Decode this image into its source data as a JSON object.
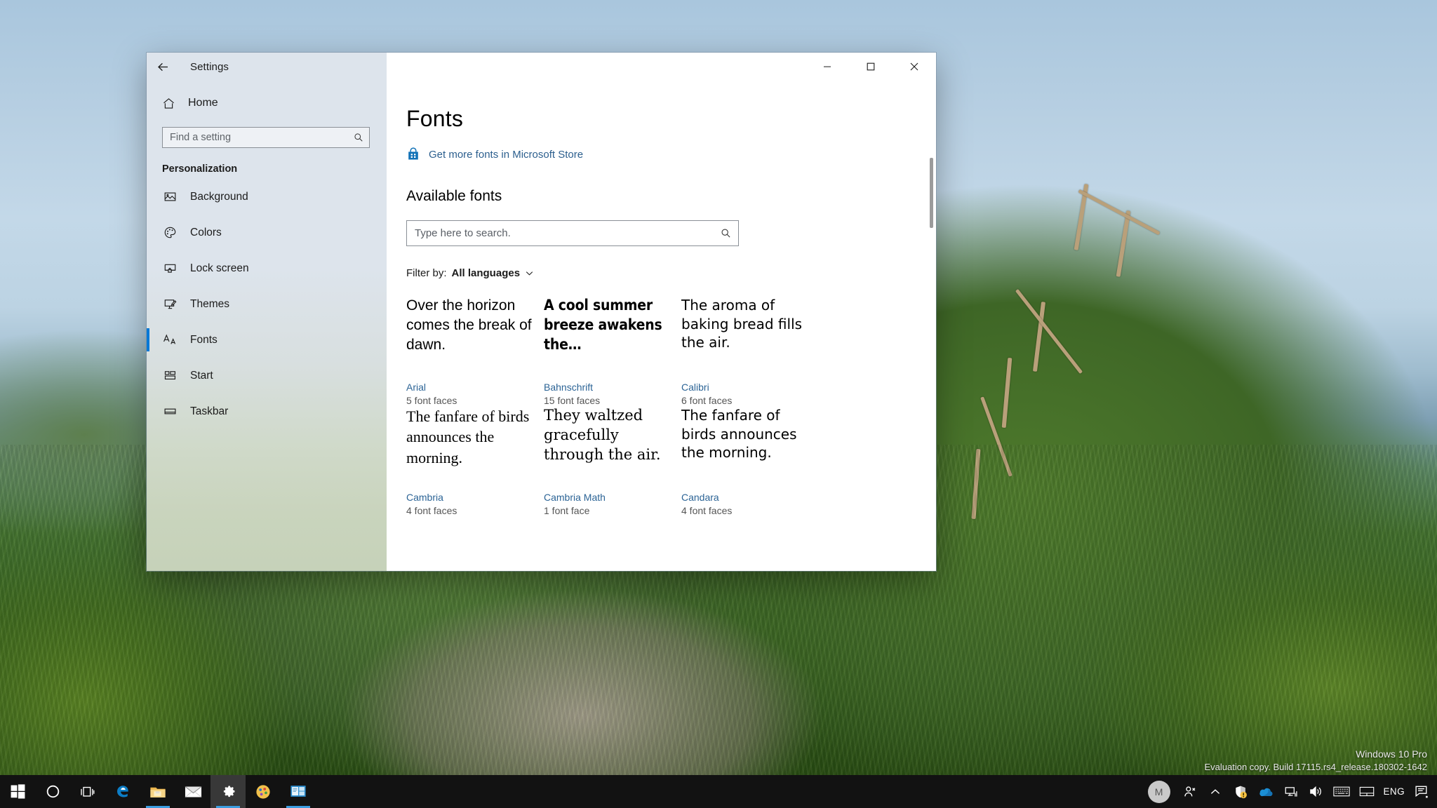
{
  "desktop": {
    "watermark": {
      "line1": "Windows 10 Pro",
      "line2": "Evaluation copy. Build 17115.rs4_release.180302-1642"
    }
  },
  "window": {
    "title": "Settings",
    "back_icon": "back-arrow-icon",
    "controls": {
      "minimize": "─",
      "maximize": "☐",
      "close": "✕"
    }
  },
  "sidebar": {
    "home_label": "Home",
    "search": {
      "placeholder": "Find a setting",
      "value": "",
      "icon": "search-icon"
    },
    "group_heading": "Personalization",
    "items": [
      {
        "label": "Background",
        "icon": "picture-icon",
        "selected": false
      },
      {
        "label": "Colors",
        "icon": "palette-icon",
        "selected": false
      },
      {
        "label": "Lock screen",
        "icon": "lock-screen-icon",
        "selected": false
      },
      {
        "label": "Themes",
        "icon": "themes-icon",
        "selected": false
      },
      {
        "label": "Fonts",
        "icon": "font-aa-icon",
        "selected": true
      },
      {
        "label": "Start",
        "icon": "start-tiles-icon",
        "selected": false
      },
      {
        "label": "Taskbar",
        "icon": "taskbar-icon",
        "selected": false
      }
    ],
    "accent_color": "#0078d7"
  },
  "content": {
    "page_title": "Fonts",
    "store_link": {
      "label": "Get more fonts in Microsoft Store",
      "icon": "microsoft-store-icon",
      "color": "#2c5f8e"
    },
    "available_heading": "Available fonts",
    "search": {
      "placeholder": "Type here to search.",
      "value": "",
      "icon": "search-icon"
    },
    "filter": {
      "label": "Filter by:",
      "value": "All languages",
      "chevron": "chevron-down-icon"
    },
    "fonts": [
      {
        "preview": "Over the horizon comes the break of dawn.",
        "name": "Arial",
        "faces": "5 font faces",
        "style": "p-arial"
      },
      {
        "preview": "A cool summer breeze awakens the…",
        "name": "Bahnschrift",
        "faces": "15 font faces",
        "style": "p-bahn"
      },
      {
        "preview": "The aroma of baking bread fills the air.",
        "name": "Calibri",
        "faces": "6 font faces",
        "style": "p-calibri"
      },
      {
        "preview": "The fanfare of birds announces the morning.",
        "name": "Cambria",
        "faces": "4 font faces",
        "style": "p-cambria"
      },
      {
        "preview": "They waltzed gracefully through the air.",
        "name": "Cambria Math",
        "faces": "1 font face",
        "style": "p-cambriamath"
      },
      {
        "preview": "The fanfare of birds announces the morning.",
        "name": "Candara",
        "faces": "4 font faces",
        "style": "p-candara"
      }
    ]
  },
  "taskbar": {
    "items": [
      {
        "icon": "windows-start-icon",
        "name": "start-button",
        "running": false,
        "active": false
      },
      {
        "icon": "cortana-circle-icon",
        "name": "cortana-button",
        "running": false,
        "active": false
      },
      {
        "icon": "task-view-icon",
        "name": "task-view-button",
        "running": false,
        "active": false
      },
      {
        "icon": "edge-browser-icon",
        "name": "edge-button",
        "running": false,
        "active": false
      },
      {
        "icon": "file-explorer-icon",
        "name": "file-explorer-button",
        "running": true,
        "active": false
      },
      {
        "icon": "mail-icon",
        "name": "mail-button",
        "running": false,
        "active": false
      },
      {
        "icon": "settings-gear-icon",
        "name": "settings-button",
        "running": true,
        "active": true
      },
      {
        "icon": "paint-palette-icon",
        "name": "paint-button",
        "running": false,
        "active": false
      },
      {
        "icon": "remote-desktop-icon",
        "name": "remote-desktop-button",
        "running": true,
        "active": false
      }
    ],
    "tray": {
      "avatar_initial": "M",
      "items": [
        {
          "icon": "people-icon",
          "name": "people-tray-icon"
        },
        {
          "icon": "chevron-up-icon",
          "name": "show-hidden-icons-button"
        },
        {
          "icon": "defender-shield-icon",
          "name": "windows-defender-tray-icon"
        },
        {
          "icon": "onedrive-cloud-icon",
          "name": "onedrive-tray-icon"
        },
        {
          "icon": "network-icon",
          "name": "network-tray-icon"
        },
        {
          "icon": "volume-icon",
          "name": "volume-tray-icon"
        },
        {
          "icon": "keyboard-icon",
          "name": "touch-keyboard-button"
        },
        {
          "icon": "touchpad-icon",
          "name": "touchpad-tray-icon"
        }
      ],
      "language": "ENG",
      "action_center_icon": "action-center-icon"
    }
  }
}
